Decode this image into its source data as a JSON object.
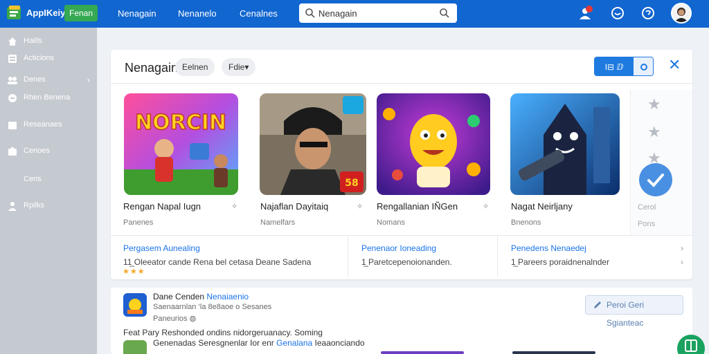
{
  "topbar": {
    "brand": "AppIKeiy",
    "badge": "Fenan",
    "nav": [
      "Nenagain",
      "Nenanelo",
      "Cenalnes"
    ],
    "search_value": "Nenagain"
  },
  "sidebar": {
    "items": [
      {
        "label": "Haiils",
        "icon": "home-icon"
      },
      {
        "label": "Acticions",
        "icon": "grid-icon"
      },
      {
        "label": "Denes",
        "icon": "users-icon"
      },
      {
        "label": "Rhen Benena",
        "icon": "circle-icon"
      },
      {
        "label": "Reseanaes",
        "icon": "folder-icon"
      },
      {
        "label": "Cenoes",
        "icon": "briefcase-icon"
      },
      {
        "label": "Ceris",
        "icon": ""
      },
      {
        "label": "Rpilks",
        "icon": "user-icon"
      }
    ]
  },
  "main": {
    "title": "Nenagain",
    "pills": [
      "Eelnen",
      "Fdie▾"
    ],
    "toggle_label": "I⊟ ⅅ",
    "apps": [
      {
        "name": "Rengan Napal Iugn",
        "sub": "Panenes",
        "art": "NORCIN"
      },
      {
        "name": "Najaflan Dayitaiq",
        "sub": "Namelfars",
        "art": "58"
      },
      {
        "name": "Rengallanian IÑGen",
        "sub": "Nomans",
        "art": ""
      },
      {
        "name": "Nagat Neirljany",
        "sub": "Bnenons",
        "art": ""
      }
    ],
    "side_labels": [
      "Cerol",
      "Pons"
    ],
    "links": [
      {
        "title": "Pergasem Aunealing",
        "text": "11̲ Oleeator cande Rena bel cetasa Deane Sadena"
      },
      {
        "title": "Penenaor Ioneading",
        "text": "1̲ Paretcepenoionanden."
      },
      {
        "title": "Penedens Nenaedej",
        "text": "1̲ Pareers poraidnenalnder"
      }
    ],
    "rating": "★★★"
  },
  "bottom": {
    "title_plain": "Dane Cenden ",
    "title_link": "Nenaiaenio",
    "meta": "Saenaarnlan ‘la 8e8aoe o Sesanes",
    "publisher": "Paneurios",
    "line1": "Feat Pary Reshonded ondins nidorgeruanacy. Soming",
    "line2_a": "Genenadas Seresgnenlar Ior enr ",
    "line2_link": "Genalana",
    "line2_b": " Ieaaonciando",
    "button": "Peroi Geri Sgianteac"
  },
  "colors": {
    "topbar": "#1166d0",
    "accent": "#1a73e8",
    "sidebar": "#c5c9d0",
    "badge": "#34a853",
    "fab": "#1aa260"
  }
}
